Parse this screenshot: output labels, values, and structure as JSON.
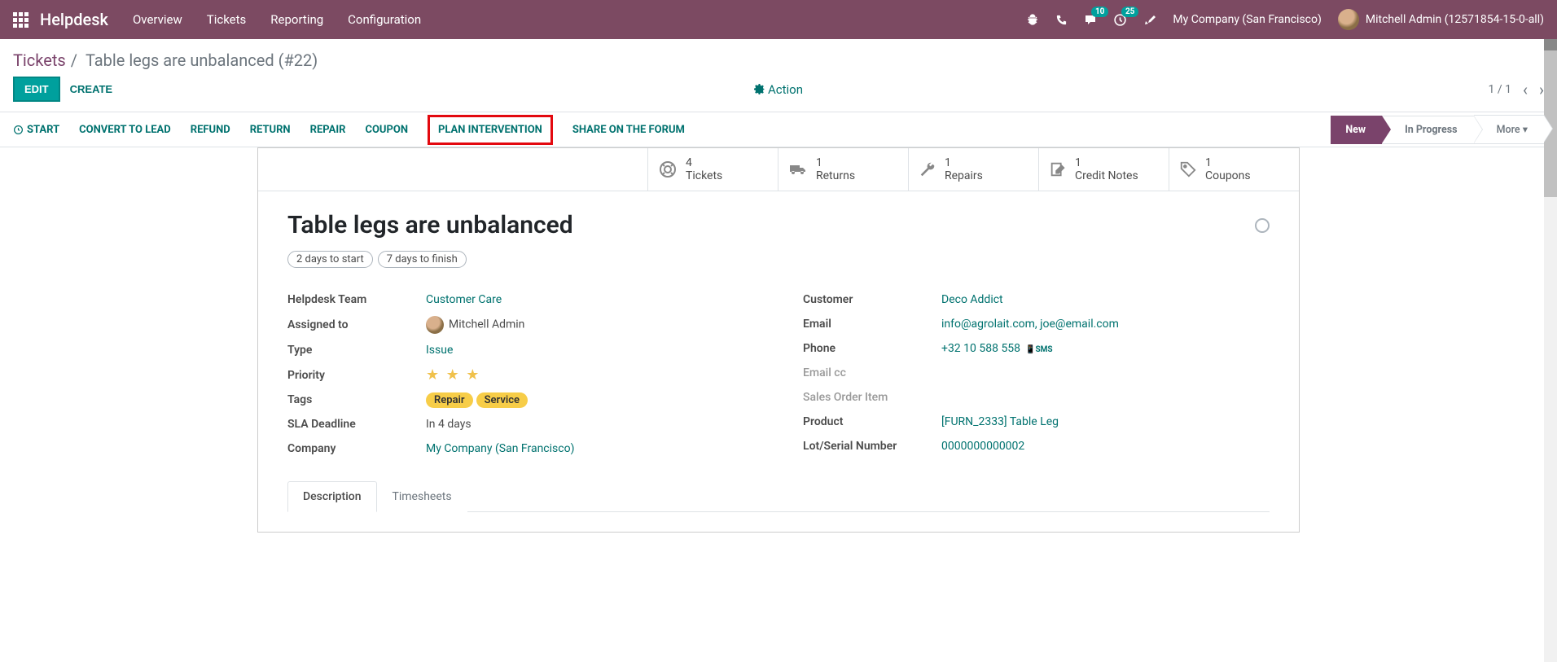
{
  "topbar": {
    "app_title": "Helpdesk",
    "nav": [
      "Overview",
      "Tickets",
      "Reporting",
      "Configuration"
    ],
    "badge_messages": "10",
    "badge_activities": "25",
    "company": "My Company (San Francisco)",
    "user": "Mitchell Admin (12571854-15-0-all)"
  },
  "breadcrumb": {
    "root": "Tickets",
    "current": "Table legs are unbalanced (#22)"
  },
  "controls": {
    "edit": "Edit",
    "create": "Create",
    "action": "Action",
    "pager": "1 / 1"
  },
  "status_actions": {
    "start": "Start",
    "convert": "Convert to Lead",
    "refund": "Refund",
    "return": "Return",
    "repair": "Repair",
    "coupon": "Coupon",
    "plan": "Plan Intervention",
    "share": "Share on the Forum"
  },
  "stages": {
    "new": "New",
    "in_progress": "In Progress",
    "more": "More"
  },
  "smart_buttons": {
    "tickets": {
      "count": "4",
      "label": "Tickets"
    },
    "returns": {
      "count": "1",
      "label": "Returns"
    },
    "repairs": {
      "count": "1",
      "label": "Repairs"
    },
    "credit_notes": {
      "count": "1",
      "label": "Credit Notes"
    },
    "coupons": {
      "count": "1",
      "label": "Coupons"
    }
  },
  "record": {
    "title": "Table legs are unbalanced",
    "pills": [
      "2 days to start",
      "7 days to finish"
    ],
    "left": {
      "team_label": "Helpdesk Team",
      "team": "Customer Care",
      "assigned_label": "Assigned to",
      "assigned": "Mitchell Admin",
      "type_label": "Type",
      "type": "Issue",
      "priority_label": "Priority",
      "tags_label": "Tags",
      "tags": [
        "Repair",
        "Service"
      ],
      "sla_label": "SLA Deadline",
      "sla": "In 4 days",
      "company_label": "Company",
      "company": "My Company (San Francisco)"
    },
    "right": {
      "customer_label": "Customer",
      "customer": "Deco Addict",
      "email_label": "Email",
      "email": "info@agrolait.com, joe@email.com",
      "phone_label": "Phone",
      "phone": "+32 10 588 558",
      "sms": "SMS",
      "emailcc_label": "Email cc",
      "so_label": "Sales Order Item",
      "product_label": "Product",
      "product": "[FURN_2333] Table Leg",
      "lot_label": "Lot/Serial Number",
      "lot": "0000000000002"
    }
  },
  "tabs": {
    "description": "Description",
    "timesheets": "Timesheets"
  }
}
